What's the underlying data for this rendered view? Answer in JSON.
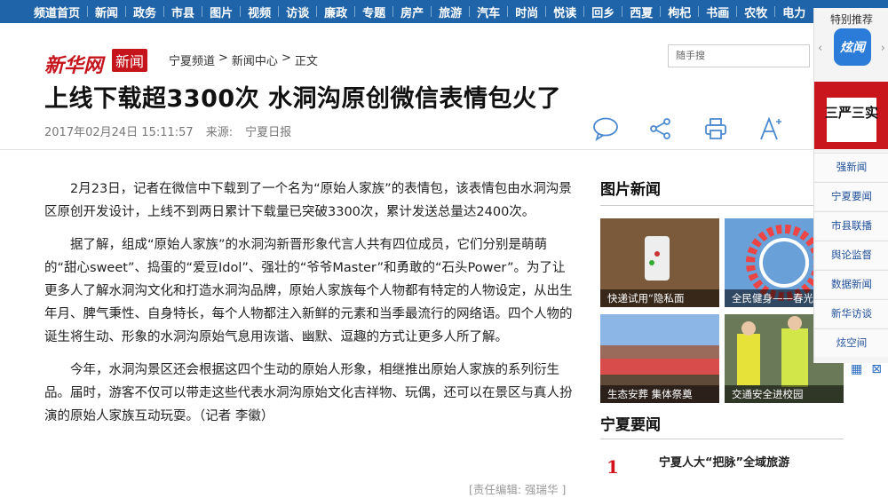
{
  "nav": [
    "频道首页",
    "新闻",
    "政务",
    "市县",
    "图片",
    "视频",
    "访谈",
    "廉政",
    "专题",
    "房产",
    "旅游",
    "汽车",
    "时尚",
    "悦读",
    "回乡",
    "西夏",
    "枸杞",
    "书画",
    "农牧",
    "电力"
  ],
  "logo": "新华网",
  "logo_badge": "新闻",
  "breadcrumb": [
    "宁夏频道",
    ">",
    "新闻中心",
    ">",
    "正文"
  ],
  "search_placeholder": "随手搜",
  "article": {
    "title": "上线下载超3300次 水洞沟原创微信表情包火了",
    "date": "2017年02月24日 15:11:57",
    "source_label": "来源:",
    "source": "宁夏日报",
    "paragraphs": [
      "2月23日，记者在微信中下载到了一个名为“原始人家族”的表情包，该表情包由水洞沟景区原创开发设计，上线不到两日累计下载量已突破3300次，累计发送总量达2400次。",
      "据了解，组成“原始人家族”的水洞沟新晋形象代言人共有四位成员，它们分别是萌萌的“甜心sweet”、捣蛋的“爱豆Idol”、强壮的“爷爷Master”和勇敢的“石头Power”。为了让更多人了解水洞沟文化和打造水洞沟品牌，原始人家族每个人物都有特定的人物设定，从出生年月、脾气秉性、自身特长，每个人物都注入新鲜的元素和当季最流行的网络语。四个人物的诞生将生动、形象的水洞沟原始气息用诙谐、幽默、逗趣的方式让更多人所了解。",
      "今年，水洞沟景区还会根据这四个生动的原始人形象，相继推出原始人家族的系列衍生品。届时，游客不仅可以带走这些代表水洞沟原始文化吉祥物、玩偶，还可以在景区与真人扮演的原始人家族互动玩耍。（记者 李徽）"
    ],
    "editor": "[责任编辑: 强瑞华 ]"
  },
  "photo_news": {
    "title": "图片新闻",
    "items": [
      {
        "caption": "快递试用“隐私面",
        "color": "#7a5a3a"
      },
      {
        "caption": "全民健身——春光",
        "color": "#6aa0d8"
      },
      {
        "caption": "生态安葬 集体祭奠",
        "color": "#9a6a5a"
      },
      {
        "caption": "交通安全进校园",
        "color": "#6a7a58"
      }
    ]
  },
  "ningxia_news": {
    "title": "宁夏要闻",
    "items": [
      {
        "rank": "1",
        "text": "宁夏人大“把脉”全域旅游"
      }
    ]
  },
  "float_sidebar": {
    "header": "特别推荐",
    "app_label": "炫闻",
    "promo": "三严三实",
    "links": [
      "强新闻",
      "宁夏要闻",
      "市县联播",
      "舆论监督",
      "数据新闻",
      "新华访谈",
      "炫空间"
    ]
  }
}
